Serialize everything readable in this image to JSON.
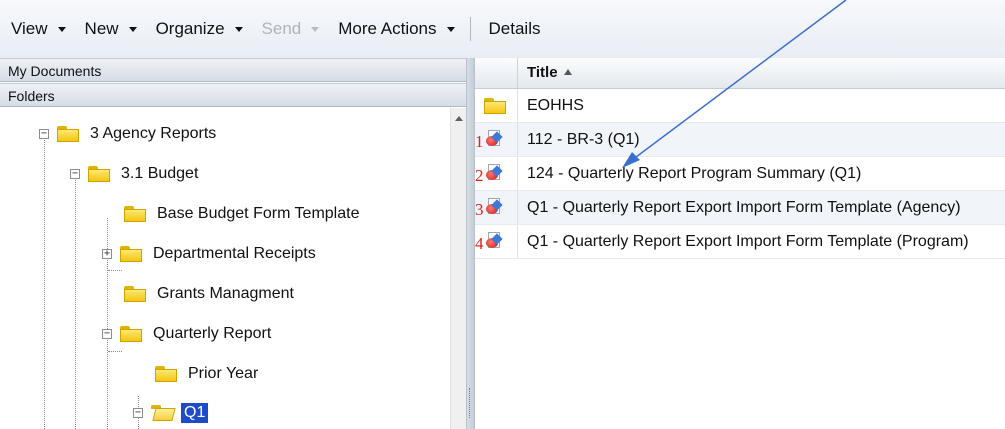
{
  "toolbar": {
    "items": [
      {
        "label": "View",
        "has_menu": true,
        "enabled": true
      },
      {
        "label": "New",
        "has_menu": true,
        "enabled": true
      },
      {
        "label": "Organize",
        "has_menu": true,
        "enabled": true
      },
      {
        "label": "Send",
        "has_menu": true,
        "enabled": false
      },
      {
        "label": "More Actions",
        "has_menu": true,
        "enabled": true
      }
    ],
    "details_label": "Details"
  },
  "left_pane": {
    "my_documents_label": "My Documents",
    "folders_label": "Folders",
    "tree": [
      {
        "label": "3 Agency Reports",
        "level": 0,
        "toggle": "minus",
        "icon": "folder-icon"
      },
      {
        "label": "3.1 Budget",
        "level": 1,
        "toggle": "minus",
        "icon": "folder-icon"
      },
      {
        "label": "Base Budget Form Template",
        "level": 2,
        "toggle": "none",
        "icon": "folder-icon"
      },
      {
        "label": "Departmental Receipts",
        "level": 2,
        "toggle": "plus",
        "icon": "folder-icon"
      },
      {
        "label": "Grants Managment",
        "level": 2,
        "toggle": "none",
        "icon": "folder-icon"
      },
      {
        "label": "Quarterly Report",
        "level": 2,
        "toggle": "minus",
        "icon": "folder-icon"
      },
      {
        "label": "Prior Year",
        "level": 3,
        "toggle": "none",
        "icon": "folder-icon"
      },
      {
        "label": "Q1",
        "level": 3,
        "toggle": "minus",
        "icon": "open-folder-icon",
        "selected": true
      }
    ]
  },
  "grid": {
    "title_header": "Title",
    "sort": "ascending",
    "rows": [
      {
        "number": "",
        "icon": "folder-icon",
        "title": "EOHHS"
      },
      {
        "number": "1",
        "icon": "report-icon",
        "title": "112 - BR-3 (Q1)"
      },
      {
        "number": "2",
        "icon": "report-icon",
        "title": "124 - Quarterly Report Program Summary (Q1)"
      },
      {
        "number": "3",
        "icon": "report-icon",
        "title": "Q1 - Quarterly Report Export Import Form Template (Agency)"
      },
      {
        "number": "4",
        "icon": "report-icon",
        "title": "Q1 - Quarterly Report Export Import Form Template (Program)"
      }
    ]
  },
  "colors": {
    "selection": "#1e4bc7",
    "annotation_arrow": "#3a6fd0",
    "row_number": "#e0201a",
    "folder": "#f4c612"
  }
}
